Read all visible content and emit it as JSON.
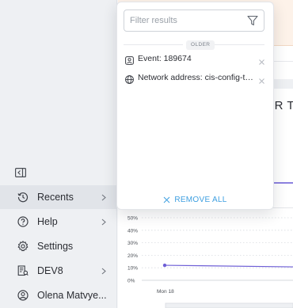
{
  "sidebar": {
    "collapse_icon": "sidebar-collapse-icon",
    "items": [
      {
        "label": "Recents",
        "icon": "history-icon",
        "chevron": true
      },
      {
        "label": "Help",
        "icon": "help-icon",
        "chevron": true
      },
      {
        "label": "Settings",
        "icon": "gear-icon",
        "chevron": false
      },
      {
        "label": "DEV8",
        "icon": "org-icon",
        "chevron": true
      },
      {
        "label": "Olena Matvye...",
        "icon": "user-icon",
        "chevron": false
      }
    ]
  },
  "background": {
    "title_fragment": "ER T"
  },
  "chart_data": {
    "type": "line",
    "y_ticks": [
      "50%",
      "40%",
      "30%",
      "20%",
      "10%",
      "0%"
    ],
    "x_ticks": [
      "Mon 18"
    ],
    "series": [
      {
        "color": "#6e5fd6",
        "points": [
          {
            "x": "Mon 18",
            "y": 12
          }
        ]
      }
    ],
    "ylim": [
      0,
      50
    ],
    "grid": true
  },
  "recents_popover": {
    "filter_placeholder": "Filter results",
    "filter_value": "",
    "section_label": "OLDER",
    "items": [
      {
        "label": "Event: 189674",
        "icon": "event-icon"
      },
      {
        "label": "Network address: cis-config-tes...",
        "icon": "globe-icon"
      }
    ],
    "remove_all_label": "REMOVE ALL"
  },
  "colors": {
    "accent_link": "#3e9fe0",
    "series": "#6e5fd6"
  }
}
